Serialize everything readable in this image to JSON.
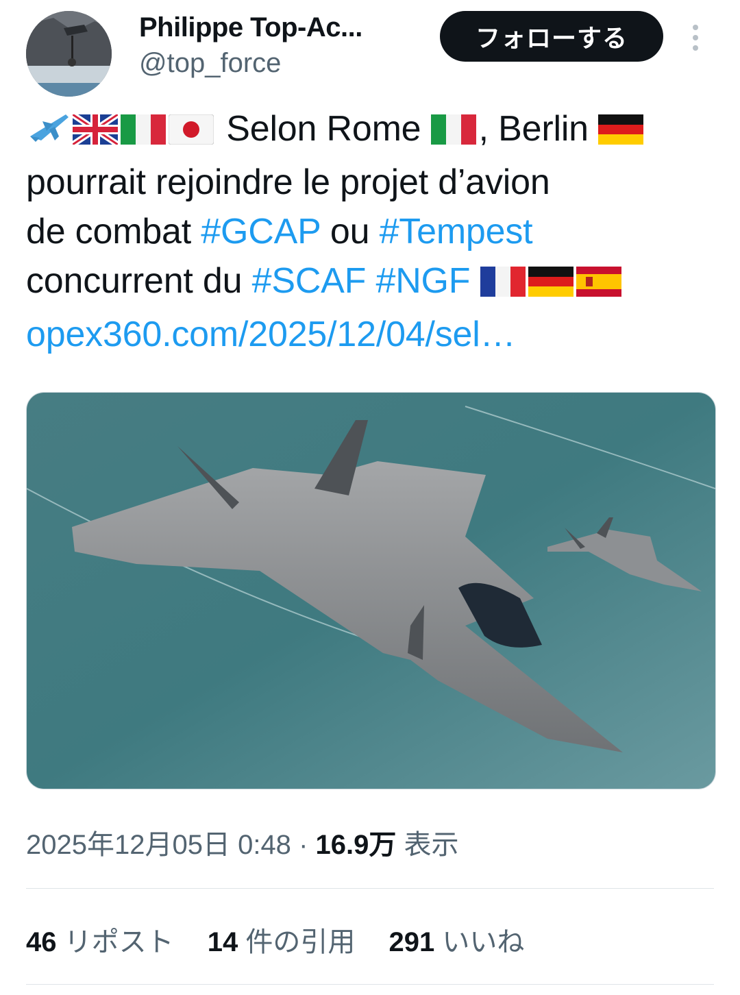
{
  "header": {
    "display_name": "Philippe Top-Ac...",
    "handle": "@top_force",
    "follow_label": "フォローする"
  },
  "tweet": {
    "text_1": "Selon Rome",
    "text_2": ", Berlin",
    "text_3": "pourrait rejoindre le projet d’avion",
    "text_4": "de combat",
    "hashtag_gcap": "#GCAP",
    "text_5": "ou",
    "hashtag_tempest": "#Tempest",
    "text_6": "concurrent du",
    "hashtag_scaf": "#SCAF",
    "hashtag_ngf": "#NGF",
    "link": "opex360.com/2025/12/04/sel…"
  },
  "meta": {
    "timestamp": "2025年12月05日 0:48",
    "separator": "·",
    "views_count": "16.9万",
    "views_label": "表示"
  },
  "stats": {
    "reposts_count": "46",
    "reposts_label": "リポスト",
    "quotes_count": "14",
    "quotes_label": "件の引用",
    "likes_count": "291",
    "likes_label": "いいね"
  },
  "colors": {
    "link": "#1d9bf0",
    "text": "#0f1419",
    "secondary": "#536471",
    "follow_bg": "#0f1419"
  },
  "icons": [
    "airplane-icon",
    "uk-flag-icon",
    "italy-flag-icon",
    "japan-flag-icon",
    "germany-flag-icon",
    "france-flag-icon",
    "spain-flag-icon",
    "more-icon"
  ]
}
